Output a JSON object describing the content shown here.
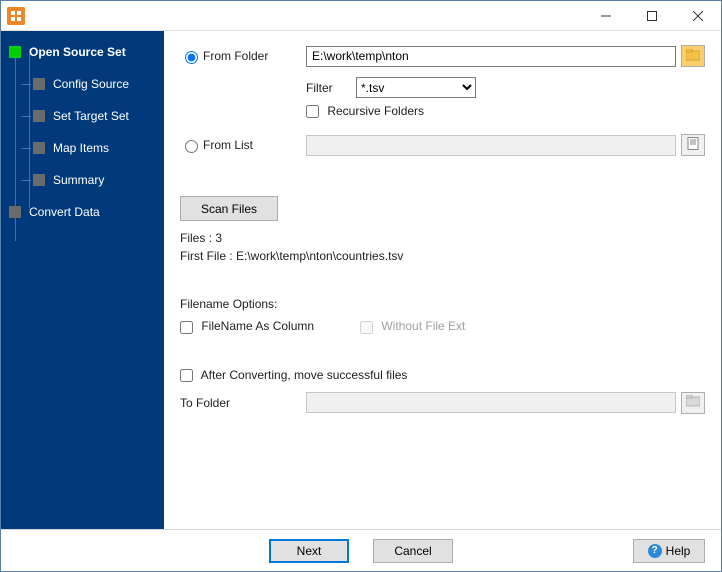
{
  "nav": {
    "open_source_set": "Open Source Set",
    "config_source": "Config Source",
    "set_target_set": "Set Target Set",
    "map_items": "Map Items",
    "summary": "Summary",
    "convert_data": "Convert Data"
  },
  "source": {
    "from_folder_label": "From Folder",
    "from_folder_value": "E:\\work\\temp\\nton",
    "filter_label": "Filter",
    "filter_value": "*.tsv",
    "recursive_label": "Recursive Folders",
    "from_list_label": "From List",
    "from_list_value": ""
  },
  "scan": {
    "button_label": "Scan Files",
    "files_label": "Files : 3",
    "first_file_label": "First File : E:\\work\\temp\\nton\\countries.tsv"
  },
  "filename_options": {
    "title": "Filename Options:",
    "as_column": "FileName As Column",
    "without_ext": "Without File Ext"
  },
  "after": {
    "move_label": "After Converting, move successful files",
    "to_folder_label": "To Folder",
    "to_folder_value": ""
  },
  "footer": {
    "next": "Next",
    "cancel": "Cancel",
    "help": "Help"
  }
}
